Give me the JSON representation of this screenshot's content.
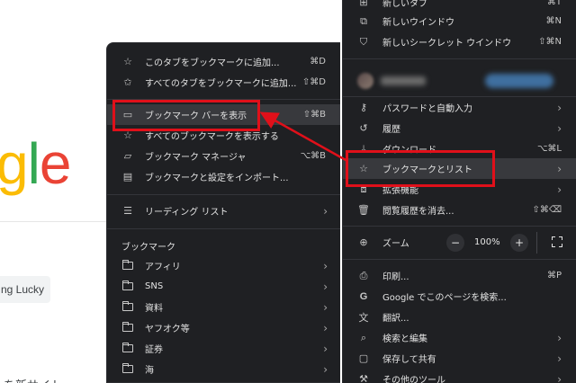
{
  "background_page": {
    "logo_letters": [
      "g",
      "l",
      "e"
    ],
    "lucky_button": "ng Lucky",
    "bottom_text": "を新サイト"
  },
  "bookmarks_menu": {
    "items": [
      {
        "icon": "star-icon",
        "label": "このタブをブックマークに追加...",
        "shortcut": "⌘D"
      },
      {
        "icon": "stars-icon",
        "label": "すべてのタブをブックマークに追加...",
        "shortcut": "⇧⌘D"
      },
      {
        "icon": "bookmark-bar-icon",
        "label": "ブックマーク バーを表示",
        "shortcut": "⇧⌘B"
      },
      {
        "icon": "star-icon",
        "label": "すべてのブックマークを表示する",
        "shortcut": ""
      },
      {
        "icon": "bookmark-manager-icon",
        "label": "ブックマーク マネージャ",
        "shortcut": "⌥⌘B"
      },
      {
        "icon": "import-icon",
        "label": "ブックマークと設定をインポート...",
        "shortcut": ""
      }
    ],
    "reading_list": "リーディング リスト",
    "bookmarks_title": "ブックマーク",
    "folders": [
      "アフィリ",
      "SNS",
      "資料",
      "ヤフオク等",
      "証券",
      "海"
    ]
  },
  "chrome_menu": {
    "top_items": [
      {
        "icon": "new-tab-icon",
        "label": "新しいタブ",
        "shortcut": "⌘T"
      },
      {
        "icon": "new-window-icon",
        "label": "新しいウインドウ",
        "shortcut": "⌘N"
      },
      {
        "icon": "incognito-icon",
        "label": "新しいシークレット ウインドウ",
        "shortcut": "⇧⌘N"
      }
    ],
    "middle_items": [
      {
        "icon": "key-icon",
        "label": "パスワードと自動入力",
        "shortcut": "",
        "arrow": true
      },
      {
        "icon": "history-icon",
        "label": "履歴",
        "shortcut": "",
        "arrow": true
      },
      {
        "icon": "download-icon",
        "label": "ダウンロード",
        "shortcut": "⌥⌘L",
        "arrow": false
      },
      {
        "icon": "star-icon",
        "label": "ブックマークとリスト",
        "shortcut": "",
        "arrow": true
      },
      {
        "icon": "extensions-icon",
        "label": "拡張機能",
        "shortcut": "",
        "arrow": true
      },
      {
        "icon": "trash-icon",
        "label": "閲覧履歴を消去...",
        "shortcut": "⇧⌘⌫",
        "arrow": false
      }
    ],
    "zoom": {
      "label": "ズーム",
      "minus": "−",
      "value": "100%",
      "plus": "+"
    },
    "bottom_items": [
      {
        "icon": "print-icon",
        "label": "印刷...",
        "shortcut": "⌘P",
        "arrow": false
      },
      {
        "icon": "google-icon",
        "label": "Google でこのページを検索...",
        "shortcut": "",
        "arrow": false
      },
      {
        "icon": "translate-icon",
        "label": "翻訳...",
        "shortcut": "",
        "arrow": false
      },
      {
        "icon": "search-edit-icon",
        "label": "検索と編集",
        "shortcut": "",
        "arrow": true
      },
      {
        "icon": "save-share-icon",
        "label": "保存して共有",
        "shortcut": "",
        "arrow": true
      },
      {
        "icon": "tools-icon",
        "label": "その他のツール",
        "shortcut": "",
        "arrow": true
      }
    ]
  },
  "colors": {
    "menu_bg": "#1f2023",
    "highlight": "#38393d",
    "annotation_red": "#e0101a"
  }
}
